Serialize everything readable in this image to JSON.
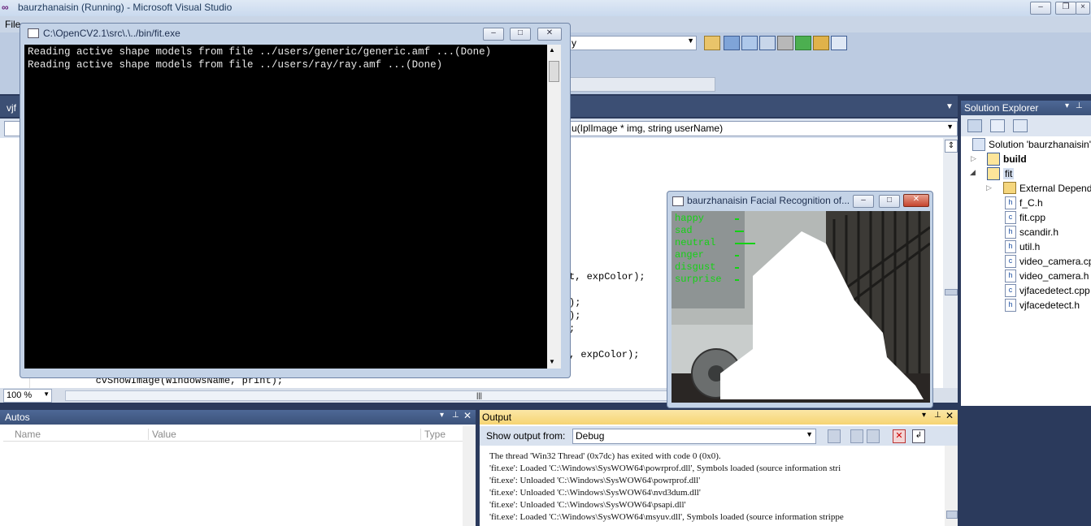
{
  "vs": {
    "title": "baurzhanaisin (Running) - Microsoft Visual Studio",
    "menu_file": "File",
    "config_dropdown": "y",
    "editor_tab": "vjf",
    "member_dropdown": "u(IplImage * img, string userName)",
    "zoom": "100 %"
  },
  "code": {
    "line1": "t, expColor);",
    "line2": ");",
    "line3": ");",
    "line4": ";",
    "line5": ", expColor);",
    "line6": "        cvShowImage(WindowsName, print);"
  },
  "console": {
    "title": "C:\\OpenCV2.1\\src\\.\\../bin/fit.exe",
    "lines": [
      "Reading active shape models from file ../users/generic/generic.amf ...(Done)",
      "Reading active shape models from file ../users/ray/ray.amf ...(Done)"
    ]
  },
  "face_window": {
    "title": "baurzhanaisin Facial Recognition of...",
    "emotions": [
      {
        "label": "happy",
        "level": 0.1
      },
      {
        "label": "sad",
        "level": 0.25
      },
      {
        "label": "neutral",
        "level": 0.55
      },
      {
        "label": "anger",
        "level": 0.1
      },
      {
        "label": "disgust",
        "level": 0.1
      },
      {
        "label": "surprise",
        "level": 0.1
      }
    ]
  },
  "solution_explorer": {
    "title": "Solution Explorer",
    "solution": "Solution 'baurzhanaisin'",
    "items": [
      {
        "label": "build",
        "bold": true
      },
      {
        "label": "fit",
        "bold": false
      },
      {
        "label": "External Depende",
        "bold": false
      },
      {
        "label": "f_C.h",
        "bold": false
      },
      {
        "label": "fit.cpp",
        "bold": false
      },
      {
        "label": "scandir.h",
        "bold": false
      },
      {
        "label": "util.h",
        "bold": false
      },
      {
        "label": "video_camera.cp",
        "bold": false
      },
      {
        "label": "video_camera.h",
        "bold": false
      },
      {
        "label": "vjfacedetect.cpp",
        "bold": false
      },
      {
        "label": "vjfacedetect.h",
        "bold": false
      }
    ]
  },
  "autos": {
    "title": "Autos",
    "col_name": "Name",
    "col_value": "Value",
    "col_type": "Type"
  },
  "output": {
    "title": "Output",
    "show_from_label": "Show output from:",
    "show_from_value": "Debug",
    "lines": [
      "The thread 'Win32 Thread' (0x7dc) has exited with code 0 (0x0).",
      "'fit.exe': Loaded 'C:\\Windows\\SysWOW64\\powrprof.dll', Symbols loaded (source information stri",
      "'fit.exe': Unloaded 'C:\\Windows\\SysWOW64\\powrprof.dll'",
      "'fit.exe': Unloaded 'C:\\Windows\\SysWOW64\\nvd3dum.dll'",
      "'fit.exe': Unloaded 'C:\\Windows\\SysWOW64\\psapi.dll'",
      "'fit.exe': Loaded 'C:\\Windows\\SysWOW64\\msyuv.dll', Symbols loaded (source information strippe"
    ]
  },
  "colors": {
    "emotion_text": "#14d214",
    "console_bg": "#000000",
    "output_header": "#f6d473"
  }
}
